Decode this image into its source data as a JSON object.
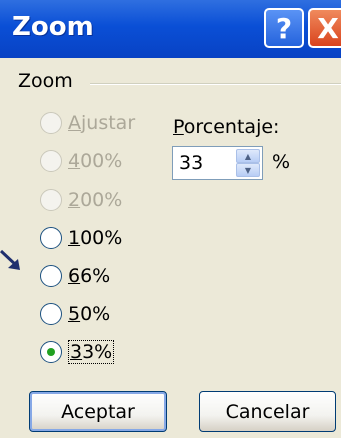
{
  "window": {
    "title": "Zoom",
    "help_glyph": "?",
    "close_glyph": "X"
  },
  "group": {
    "label": "Zoom"
  },
  "options": [
    {
      "label_pre": "",
      "label_u": "A",
      "label_post": "justar",
      "enabled": false,
      "checked": false
    },
    {
      "label_pre": "",
      "label_u": "4",
      "label_post": "00%",
      "enabled": false,
      "checked": false
    },
    {
      "label_pre": "",
      "label_u": "2",
      "label_post": "00%",
      "enabled": false,
      "checked": false
    },
    {
      "label_pre": "",
      "label_u": "1",
      "label_post": "00%",
      "enabled": true,
      "checked": false
    },
    {
      "label_pre": "",
      "label_u": "6",
      "label_post": "6%",
      "enabled": true,
      "checked": false
    },
    {
      "label_pre": "",
      "label_u": "5",
      "label_post": "0%",
      "enabled": true,
      "checked": false
    },
    {
      "label_pre": "",
      "label_u": "3",
      "label_post": "3%",
      "enabled": true,
      "checked": true
    }
  ],
  "percentage": {
    "label_u": "P",
    "label_rest": "orcentaje:",
    "value": "33",
    "unit": "%"
  },
  "buttons": {
    "ok": "Aceptar",
    "cancel": "Cancelar"
  },
  "colors": {
    "titlebar": "#0a4fd6",
    "dialog_bg": "#ece9d8",
    "radio_check": "#21a121",
    "arrow": "#1f2f6e"
  }
}
